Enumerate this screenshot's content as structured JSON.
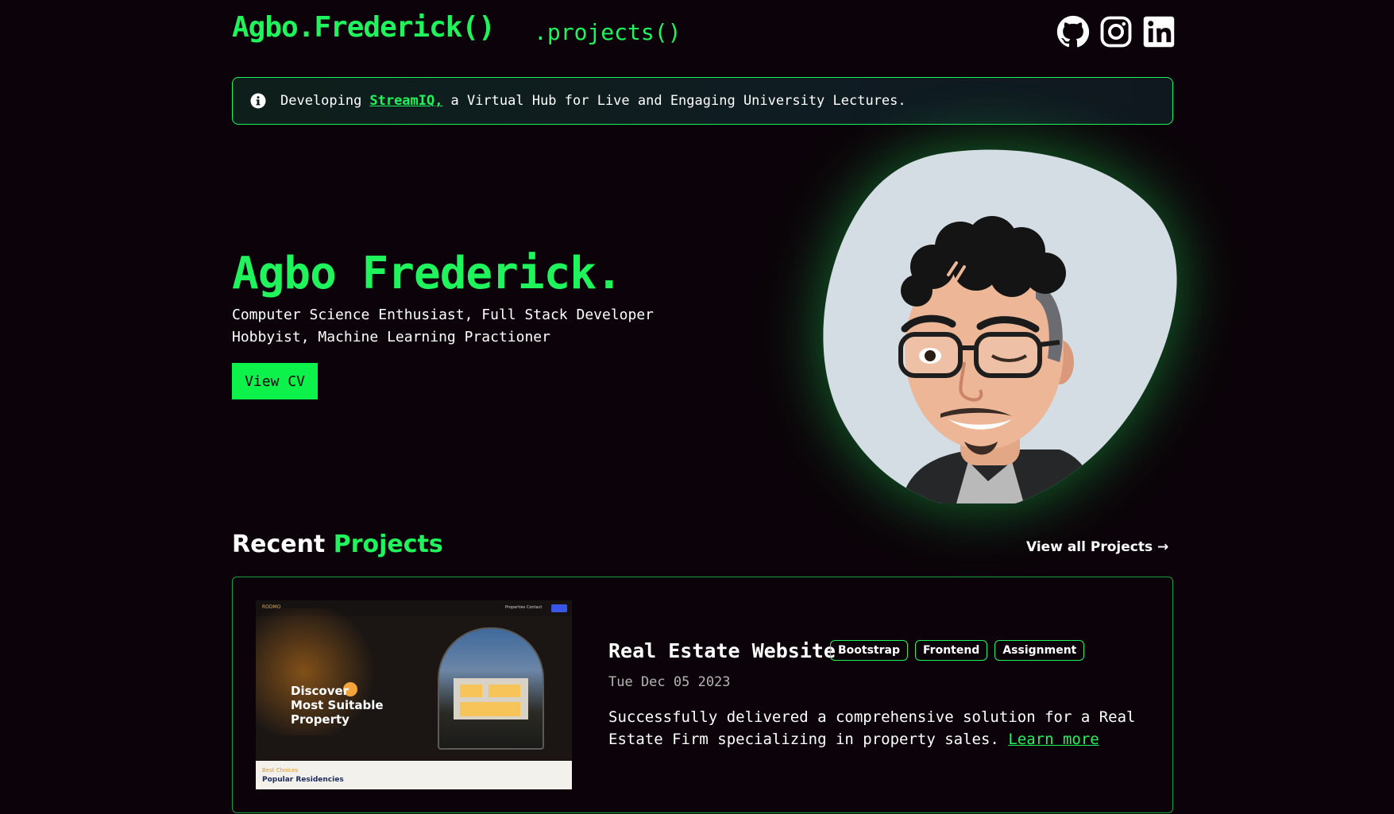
{
  "header": {
    "logo": "Agbo.Frederick()",
    "nav_projects": ".projects()",
    "social": [
      "github-icon",
      "instagram-icon",
      "linkedin-icon"
    ]
  },
  "banner": {
    "prefix": "Developing",
    "link_text": "StreamIQ,",
    "suffix": "a Virtual Hub for Live and Engaging University Lectures."
  },
  "hero": {
    "name": "Agbo Frederick.",
    "subtitle_line1": "Computer Science Enthusiast, Full Stack Developer",
    "subtitle_line2": "Hobbyist, Machine Learning Practioner",
    "cv_button": "View CV"
  },
  "recent": {
    "title_white": "Recent",
    "title_green": "Projects",
    "view_all": "View all Projects →"
  },
  "project": {
    "title": "Real Estate Website",
    "tags": [
      "Bootstrap",
      "Frontend",
      "Assignment"
    ],
    "date": "Tue Dec 05 2023",
    "description": "Successfully delivered a comprehensive solution for a Real Estate Firm specializing in property sales.",
    "learn_more": "Learn more",
    "thumbnail": {
      "brand": "RODMO",
      "menu": "Properties   Contact",
      "hero_text": "Discover\nMost Suitable\nProperty",
      "footer_small": "Best Choices",
      "footer_title": "Popular Residencies"
    }
  },
  "colors": {
    "accent": "#1ff45c",
    "background": "#0b0309"
  }
}
